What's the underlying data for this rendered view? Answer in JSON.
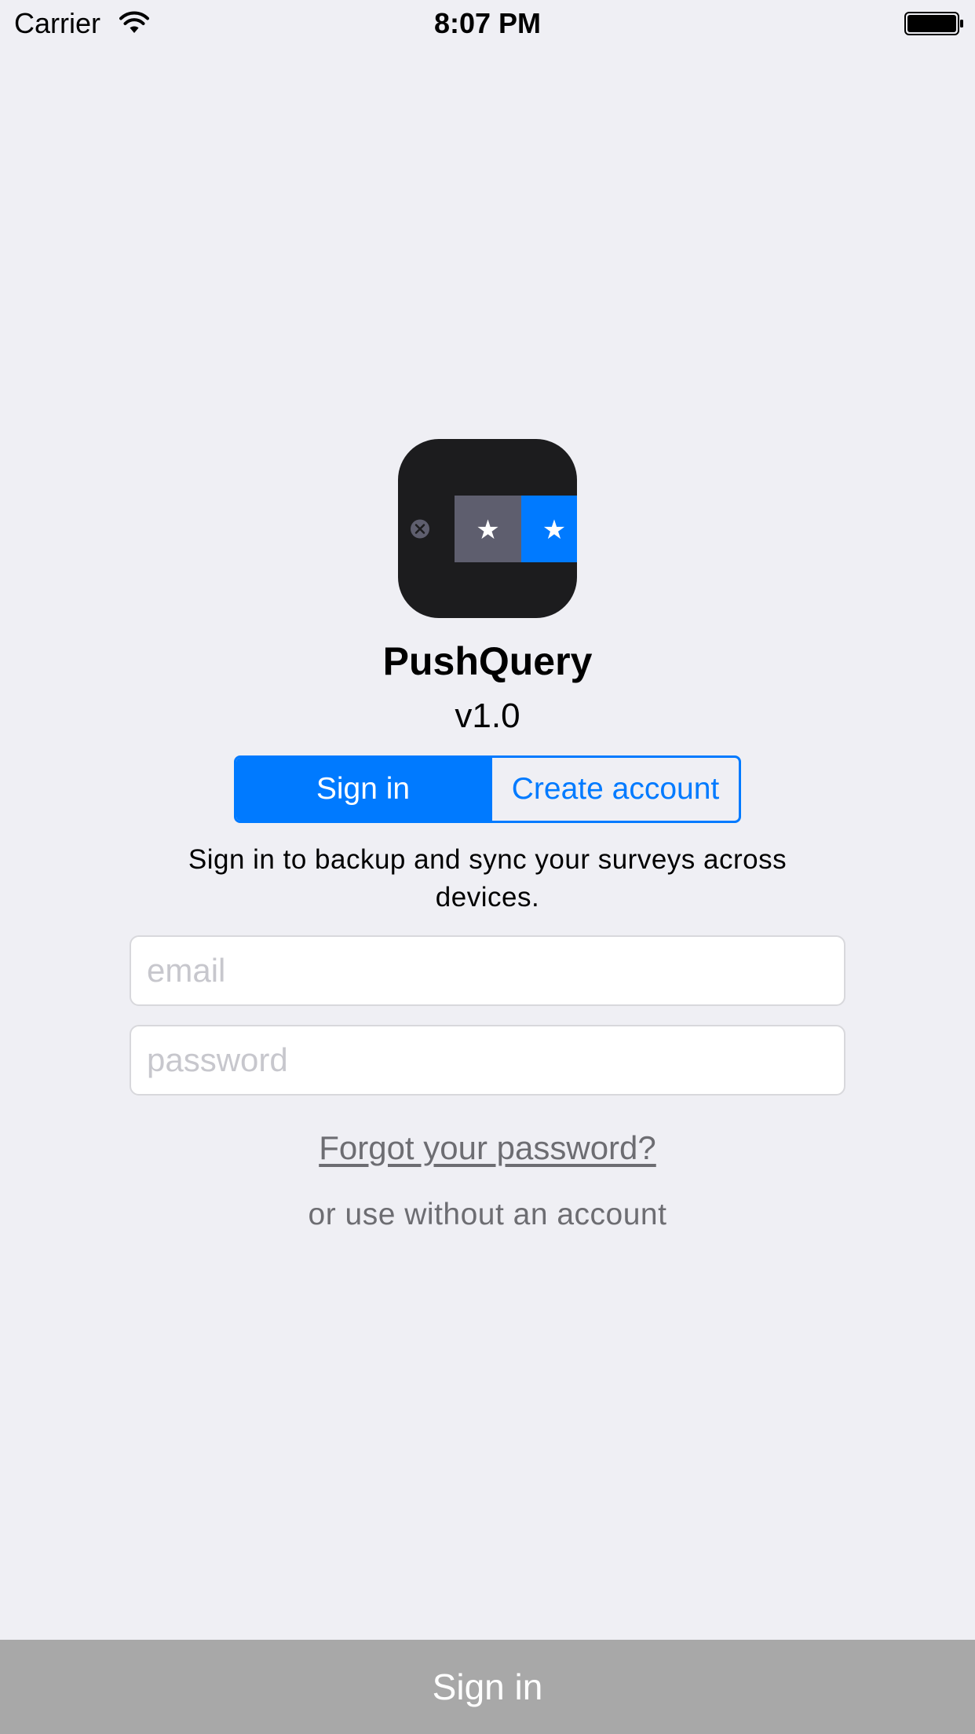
{
  "status_bar": {
    "carrier": "Carrier",
    "time": "8:07 PM",
    "wifi_icon": "wifi-icon",
    "battery_icon": "battery-full-icon"
  },
  "app": {
    "name": "PushQuery",
    "version": "v1.0",
    "icon": "app-logo-icon"
  },
  "auth_mode": {
    "options": [
      "Sign in",
      "Create account"
    ],
    "selected": "Sign in"
  },
  "description": "Sign in to backup and sync your surveys across devices.",
  "form": {
    "email": {
      "value": "",
      "placeholder": "email"
    },
    "password": {
      "value": "",
      "placeholder": "password"
    }
  },
  "links": {
    "forgot_password": "Forgot your password?",
    "use_without_account": "or use without an account"
  },
  "bottom_button": {
    "label": "Sign in"
  },
  "colors": {
    "accent": "#007aff",
    "background": "#efeff4",
    "bottom_button": "#a8a8a8",
    "secondary_text": "#6d6d72"
  }
}
